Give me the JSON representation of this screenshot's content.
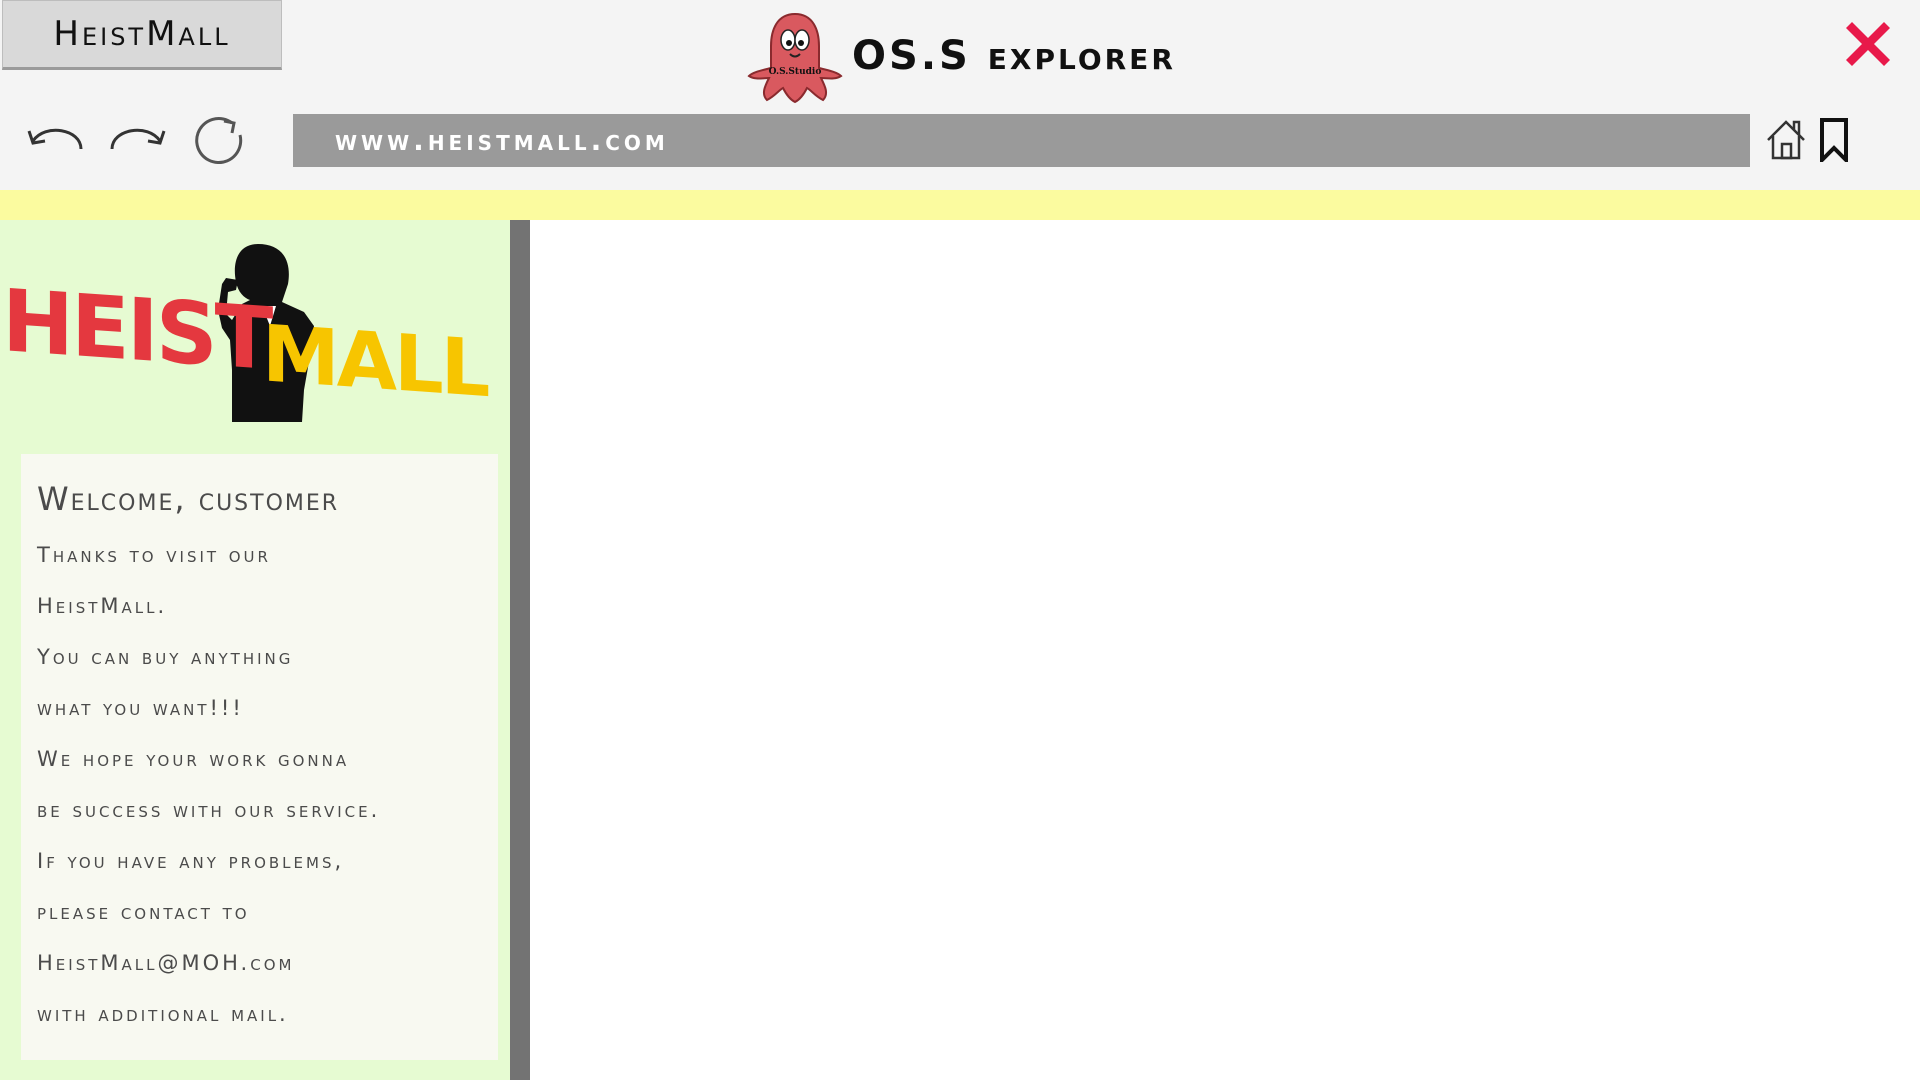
{
  "tab": {
    "label": "HeistMall"
  },
  "app": {
    "title": "OS.S explorer",
    "logo_text": "O.S.Studio",
    "logo_icon": "ghost-mascot-icon",
    "close_icon": "close-x-icon",
    "close_color": "#e8194a"
  },
  "toolbar": {
    "back_icon": "undo-arrow-icon",
    "forward_icon": "redo-arrow-icon",
    "refresh_icon": "refresh-icon",
    "home_icon": "home-icon",
    "bookmark_icon": "bookmark-icon"
  },
  "address_bar": {
    "url": "www.heistmall.com"
  },
  "site": {
    "logo_text_red": "HEIST",
    "logo_text_yellow": "MALL",
    "logo_colors": {
      "red": "#e4383f",
      "yellow": "#f7c500"
    },
    "welcome": {
      "title": "Welcome, customer",
      "lines": [
        "Thanks to visit our",
        "HeistMall.",
        "You can buy anything",
        "what you want!!!",
        "We hope your work gonna",
        "be success with our service.",
        "If you have any problems,",
        "please contact to",
        "HeistMall@MOH.com",
        "with additional mail."
      ]
    }
  },
  "colors": {
    "titlebar": "#f4f4f4",
    "address_bar": "#9a9a9a",
    "highlight_strip": "#fbfb9f",
    "sidebar": "#e6fbd2",
    "divider": "#737373"
  }
}
